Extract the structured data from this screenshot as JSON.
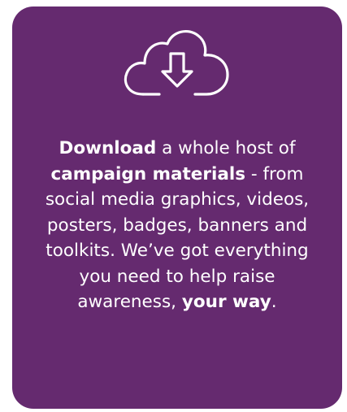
{
  "card": {
    "background": "#652a6f",
    "icon": "cloud-download-icon"
  },
  "message": {
    "download": "Download",
    "text1": " a whole host of ",
    "campaign_materials": "campaign materials",
    "text2": " - from social media graphics, videos, posters, badges, banners and toolkits. We’ve got everything you need to help raise awareness, ",
    "your_way": "your way",
    "end": "."
  }
}
